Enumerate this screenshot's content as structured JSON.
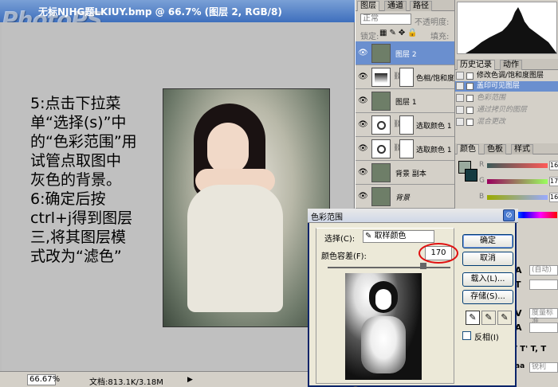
{
  "doc": {
    "title": "无标NJHG题LKIUY.bmp @ 66.7% (图层 2, RGB/8)",
    "watermark": "PhotoPS",
    "zoom": "66.67%",
    "info": "文档:813.1K/3.18M"
  },
  "instructions": {
    "lines": [
      "5:点击下拉菜",
      "单“选择(s)”中",
      "的“色彩范围”用",
      "试管点取图中",
      "灰色的背景。",
      "6:确定后按",
      "ctrl+j得到图层",
      "三,将其图层模",
      "式改为“滤色”"
    ]
  },
  "layers_panel": {
    "tabs": [
      "图层",
      "通道",
      "路径"
    ],
    "blend_mode": "正常",
    "opacity_label": "不透明度:",
    "lock_label": "锁定:",
    "fill_label": "填充:",
    "layers": [
      {
        "name": "图层 2",
        "selected": true
      },
      {
        "name": "色相/饱和度 1",
        "selected": false
      },
      {
        "name": "图层 1",
        "selected": false
      },
      {
        "name": "选取颜色 1",
        "selected": false
      },
      {
        "name": "选取颜色 1",
        "selected": false
      },
      {
        "name": "背景 副本",
        "selected": false
      },
      {
        "name": "背景",
        "selected": false
      }
    ]
  },
  "history_panel": {
    "tabs": [
      "历史记录",
      "动作"
    ],
    "items": [
      {
        "label": "修改色调/饱和度图层",
        "state": "normal"
      },
      {
        "label": "盖印可见图层",
        "state": "selected"
      },
      {
        "label": "色彩范围",
        "state": "dim"
      },
      {
        "label": "通过拷贝的图层",
        "state": "dim"
      },
      {
        "label": "混合更改",
        "state": "dim"
      }
    ]
  },
  "color_panel": {
    "tabs": [
      "颜色",
      "色板",
      "样式"
    ],
    "channels": [
      {
        "name": "R",
        "value": "16"
      },
      {
        "name": "G",
        "value": "17"
      },
      {
        "name": "B",
        "value": "16"
      }
    ],
    "colors": {
      "foreground": "#9aaa9e",
      "background": "#143a40"
    }
  },
  "char_panel": {
    "fields": [
      "(自动)",
      "",
      "度量标准",
      "",
      "0%"
    ],
    "aa_label": "锐利"
  },
  "dialog": {
    "title": "色彩范围",
    "select_label": "选择(C):",
    "select_value": "取样颜色",
    "fuzz_label": "颜色容差(F):",
    "fuzz_value": "170",
    "buttons": {
      "ok": "确定",
      "cancel": "取消",
      "load": "载入(L)...",
      "save": "存储(S)..."
    },
    "invert_label": "反相(I)"
  }
}
